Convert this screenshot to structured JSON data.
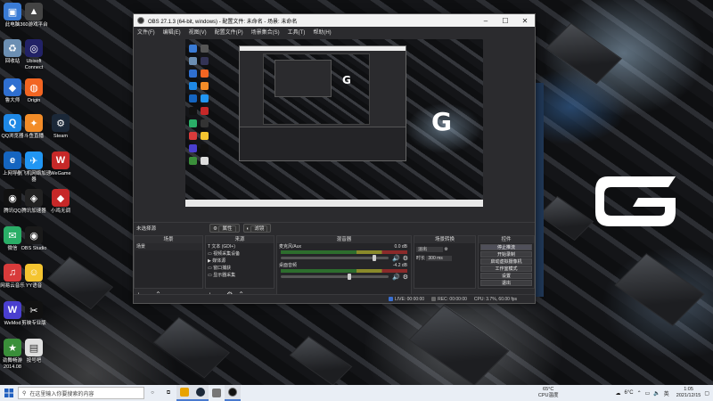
{
  "desktop_icons": [
    {
      "label": "此电脑",
      "color": "#3a7bd5",
      "glyph": "▣"
    },
    {
      "label": "回收站",
      "color": "#6c8fb3",
      "glyph": "♻"
    },
    {
      "label": "鲁大师",
      "color": "#2f6fd0",
      "glyph": "◆"
    },
    {
      "label": "QQ浏览器",
      "color": "#1e88e5",
      "glyph": "Q"
    },
    {
      "label": "上网导航",
      "color": "#1565c0",
      "glyph": "e"
    },
    {
      "label": "腾讯QQ",
      "color": "#111111",
      "glyph": "◉"
    },
    {
      "label": "微信",
      "color": "#2aae67",
      "glyph": "✉"
    },
    {
      "label": "网易云音乐",
      "color": "#d83b3b",
      "glyph": "♫"
    },
    {
      "label": "WeMod",
      "color": "#4a3fcf",
      "glyph": "W"
    },
    {
      "label": "劲舞畅游\n2014.08",
      "color": "#3a8f3a",
      "glyph": "★"
    },
    {
      "label": "360游戏平台",
      "color": "#444444",
      "glyph": "▲"
    },
    {
      "label": "Ubisoft\nConnect",
      "color": "#222266",
      "glyph": "◎"
    },
    {
      "label": "Origin",
      "color": "#f26522",
      "glyph": "◍"
    },
    {
      "label": "斗鱼直播",
      "color": "#f28c28",
      "glyph": "✦"
    },
    {
      "label": "小飞机网络加速\n器",
      "color": "#2196f3",
      "glyph": "✈"
    },
    {
      "label": "腾讯加速器",
      "color": "#222222",
      "glyph": "◈"
    },
    {
      "label": "OBS Studio",
      "color": "#1a1a1a",
      "glyph": "◉"
    },
    {
      "label": "YY语音",
      "color": "#f4c430",
      "glyph": "☺"
    },
    {
      "label": "剪映专业版",
      "color": "#111111",
      "glyph": "✂"
    },
    {
      "label": "按号吧",
      "color": "#e0e0e0",
      "glyph": "▤"
    },
    {
      "label": "Steam",
      "color": "#1b2838",
      "glyph": "⚙"
    },
    {
      "label": "WeGame",
      "color": "#c62828",
      "glyph": "W"
    },
    {
      "label": "小鸡无调",
      "color": "#c62828",
      "glyph": "◆"
    }
  ],
  "obs": {
    "title": "OBS 27.1.3 (64-bit, windows) - 配置文件: 未命名 - 场景: 未命名",
    "menu": [
      "文件(F)",
      "编辑(E)",
      "视图(V)",
      "配置文件(P)",
      "场景集合(S)",
      "工具(T)",
      "帮助(H)"
    ],
    "docks_label": "未选择源",
    "props_button": "属性",
    "filters_button": "滤镜",
    "scenes": {
      "header": "场景",
      "items": [
        "场景"
      ]
    },
    "sources": {
      "header": "来源",
      "items": [
        "文本 (GDI+)",
        "视频采集设备",
        "媒体源",
        "窗口捕获",
        "显示器采集"
      ]
    },
    "mixer": {
      "header": "混音器",
      "channels": [
        {
          "name": "麦克风/Aux",
          "db": "0.0 dB",
          "level": 0.85
        },
        {
          "name": "桌面音频",
          "db": "-4.2 dB",
          "level": 0.62
        }
      ]
    },
    "transitions": {
      "header": "场景转换",
      "type": "淡出",
      "duration_label": "时长",
      "duration": "300 ms"
    },
    "controls": {
      "header": "控件",
      "buttons": [
        "停止推流",
        "开始录制",
        "启动虚拟摄像机",
        "工作室模式",
        "设置",
        "退出"
      ]
    },
    "status": {
      "live": "LIVE: 00:00:00",
      "rec": "REC: 00:00:00",
      "cpu": "CPU: 3.7%, 60.00 fps"
    }
  },
  "taskbar": {
    "search_placeholder": "在这里输入你要搜索的内容",
    "temp": "65°C",
    "temp_label": "CPU温度",
    "weather": "6°C",
    "time": "1:05",
    "date": "2021/12/15"
  }
}
